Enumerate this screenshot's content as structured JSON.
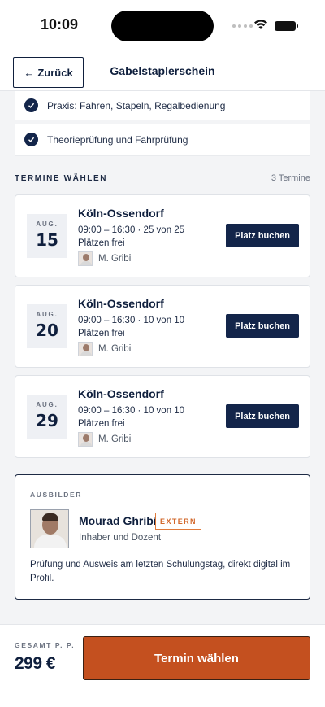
{
  "status_bar": {
    "time": "10:09"
  },
  "header": {
    "back_label": "Zurück",
    "title": "Gabelstaplerschein"
  },
  "features": [
    {
      "label": "Praxis: Fahren, Stapeln, Regalbedienung"
    },
    {
      "label": "Theorieprüfung und Fahrprüfung"
    }
  ],
  "dates_section": {
    "title": "TERMINE WÄHLEN",
    "count": "3 Termine"
  },
  "dates": [
    {
      "month": "AUG.",
      "day": "15",
      "location": "Köln-Ossendorf",
      "details": "09:00 – 16:30 · 25 von 25 Plätzen frei",
      "trainer": "M. Gribi",
      "button": "Platz buchen"
    },
    {
      "month": "AUG.",
      "day": "20",
      "location": "Köln-Ossendorf",
      "details": "09:00 – 16:30 · 10 von 10 Plätzen frei",
      "trainer": "M. Gribi",
      "button": "Platz buchen"
    },
    {
      "month": "AUG.",
      "day": "29",
      "location": "Köln-Ossendorf",
      "details": "09:00 – 16:30 · 10 von 10 Plätzen frei",
      "trainer": "M. Gribi",
      "button": "Platz buchen"
    }
  ],
  "instructor": {
    "label": "AUSBILDER",
    "name": "Mourad Ghribi",
    "badge": "EXTERN",
    "role": "Inhaber und Dozent",
    "note": "Prüfung und Ausweis am letzten Schulungstag, direkt digital im Profil."
  },
  "footer": {
    "total_label": "GESAMT P. P.",
    "price": "299 €",
    "cta": "Termin wählen"
  },
  "colors": {
    "navy": "#13254a",
    "accent": "#c4501f",
    "badge": "#e07b3c"
  }
}
